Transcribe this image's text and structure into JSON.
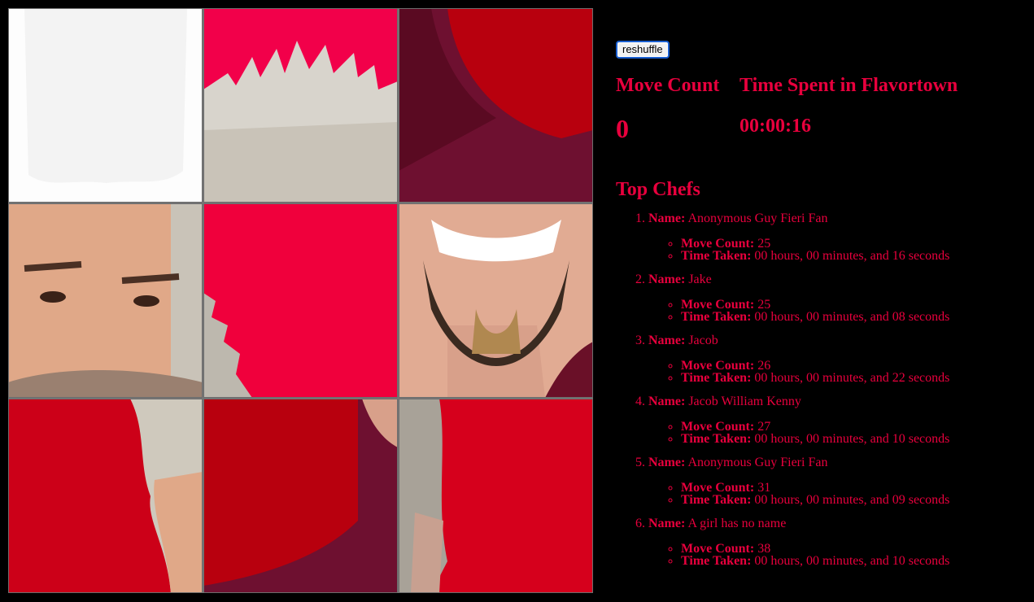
{
  "controls": {
    "reshuffle_label": "reshuffle"
  },
  "stats": {
    "move_count_label": "Move Count",
    "move_count_value": "0",
    "time_label": "Time Spent in Flavortown",
    "time_value": "00:00:16"
  },
  "leaderboard": {
    "title": "Top Chefs",
    "name_label": "Name:",
    "move_label": "Move Count:",
    "time_label": "Time Taken:",
    "entries": [
      {
        "name": "Anonymous Guy Fieri Fan",
        "moves": "25",
        "time": "00 hours, 00 minutes, and 16 seconds"
      },
      {
        "name": "Jake",
        "moves": "25",
        "time": "00 hours, 00 minutes, and 08 seconds"
      },
      {
        "name": "Jacob",
        "moves": "26",
        "time": "00 hours, 00 minutes, and 22 seconds"
      },
      {
        "name": "Jacob William Kenny",
        "moves": "27",
        "time": "00 hours, 00 minutes, and 10 seconds"
      },
      {
        "name": "Anonymous Guy Fieri Fan",
        "moves": "31",
        "time": "00 hours, 00 minutes, and 09 seconds"
      },
      {
        "name": "A girl has no name",
        "moves": "38",
        "time": "00 hours, 00 minutes, and 10 seconds"
      }
    ]
  },
  "colors": {
    "accent": "#e8003d",
    "background": "#000000",
    "tile_bg": "#d6002e",
    "blank_tile": "#fafafa"
  }
}
